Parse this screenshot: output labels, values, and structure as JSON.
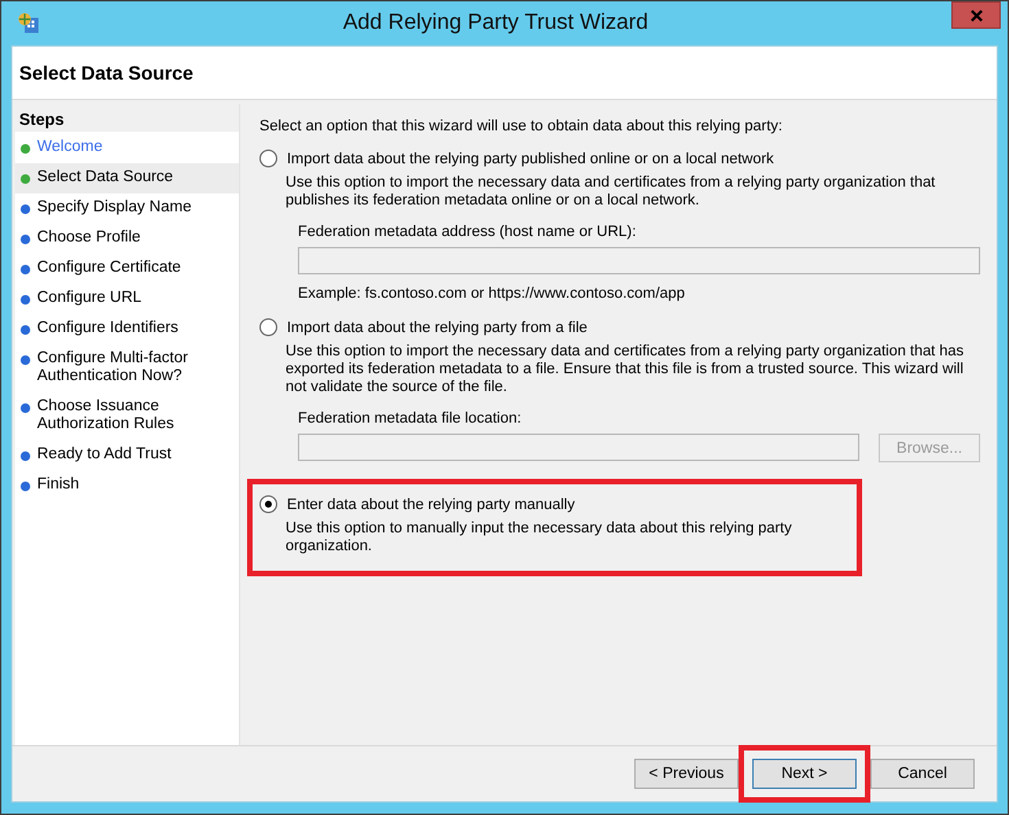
{
  "window": {
    "title": "Add Relying Party Trust Wizard"
  },
  "page_title": "Select Data Source",
  "steps": {
    "heading": "Steps",
    "items": [
      {
        "label": "Welcome",
        "done": true,
        "selected": false,
        "link": true
      },
      {
        "label": "Select Data Source",
        "done": true,
        "selected": true,
        "link": false
      },
      {
        "label": "Specify Display Name",
        "done": false,
        "selected": false,
        "link": false
      },
      {
        "label": "Choose Profile",
        "done": false,
        "selected": false,
        "link": false
      },
      {
        "label": "Configure Certificate",
        "done": false,
        "selected": false,
        "link": false
      },
      {
        "label": "Configure URL",
        "done": false,
        "selected": false,
        "link": false
      },
      {
        "label": "Configure Identifiers",
        "done": false,
        "selected": false,
        "link": false
      },
      {
        "label": "Configure Multi-factor Authentication Now?",
        "done": false,
        "selected": false,
        "link": false
      },
      {
        "label": "Choose Issuance Authorization Rules",
        "done": false,
        "selected": false,
        "link": false
      },
      {
        "label": "Ready to Add Trust",
        "done": false,
        "selected": false,
        "link": false
      },
      {
        "label": "Finish",
        "done": false,
        "selected": false,
        "link": false
      }
    ]
  },
  "intro": "Select an option that this wizard will use to obtain data about this relying party:",
  "options": [
    {
      "label": "Import data about the relying party published online or on a local network",
      "selected": false,
      "highlighted": false,
      "description": "Use this option to import the necessary data and certificates from a relying party organization that publishes its federation metadata online or on a local network.",
      "field": {
        "label": "Federation metadata address (host name or URL):",
        "disabled": true,
        "example": "Example: fs.contoso.com or https://www.contoso.com/app"
      }
    },
    {
      "label": "Import data about the relying party from a file",
      "selected": false,
      "highlighted": false,
      "description": "Use this option to import the necessary data and certificates from a relying party organization that has exported its federation metadata to a file. Ensure that this file is from a trusted source.  This wizard will not validate the source of the file.",
      "field": {
        "label": "Federation metadata file location:",
        "disabled": true,
        "button": "Browse..."
      }
    },
    {
      "label": "Enter data about the relying party manually",
      "selected": true,
      "highlighted": true,
      "description": "Use this option to manually input the necessary data about this relying party organization."
    }
  ],
  "buttons": [
    {
      "label": "< Previous",
      "default": false,
      "highlighted": false
    },
    {
      "label": "Next >",
      "default": true,
      "highlighted": true
    },
    {
      "label": "Cancel",
      "default": false,
      "highlighted": false
    }
  ]
}
